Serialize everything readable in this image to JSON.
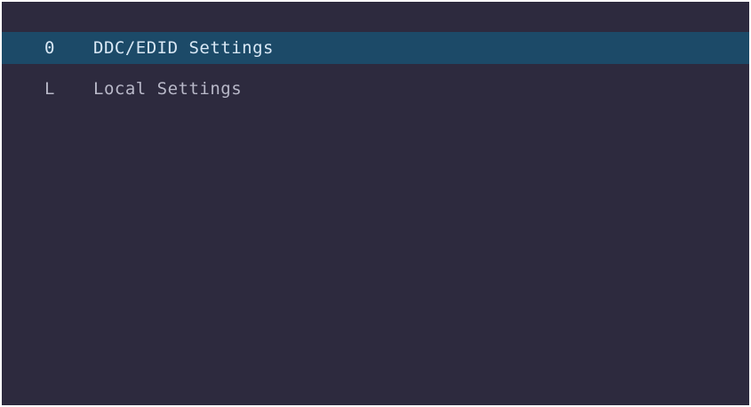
{
  "menu": {
    "items": [
      {
        "key": "0",
        "label": "DDC/EDID Settings",
        "selected": true
      },
      {
        "key": "L",
        "label": "Local Settings",
        "selected": false
      }
    ]
  },
  "colors": {
    "background": "#2d2a3e",
    "selected_row": "#1c4a68",
    "selected_text": "#d9e8f5",
    "normal_text": "#b8b8c8"
  }
}
